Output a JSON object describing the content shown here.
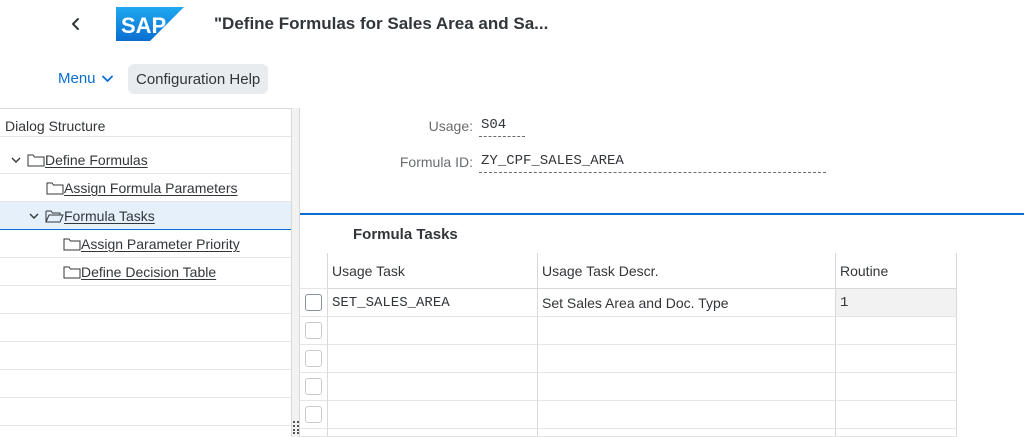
{
  "shell": {
    "title": "\"Define Formulas for Sales Area and Sa...",
    "logo_text": "SAP",
    "colors": {
      "brand": "#0a6ed1",
      "logo": "#0a7ed8"
    }
  },
  "toolbar": {
    "menu_label": "Menu",
    "config_help_label": "Configuration Help"
  },
  "dialog_structure": {
    "header": "Dialog Structure",
    "items": [
      {
        "label": "Define Formulas",
        "expanded": true,
        "level": 0
      },
      {
        "label": "Assign Formula Parameters",
        "level": 1
      },
      {
        "label": "Formula Tasks",
        "expanded": true,
        "selected": true,
        "level": 1
      },
      {
        "label": "Assign Parameter Priority",
        "level": 2
      },
      {
        "label": "Define Decision Table",
        "level": 2
      }
    ]
  },
  "form": {
    "usage_label": "Usage:",
    "usage_value": "S04",
    "formula_id_label": "Formula ID:",
    "formula_id_value": "ZY_CPF_SALES_AREA"
  },
  "formula_tasks": {
    "title": "Formula Tasks",
    "columns": [
      "Usage Task",
      "Usage Task Descr.",
      "Routine"
    ],
    "rows": [
      {
        "usage_task": "SET_SALES_AREA",
        "descr": "Set Sales Area and Doc. Type",
        "routine": "1"
      }
    ]
  }
}
